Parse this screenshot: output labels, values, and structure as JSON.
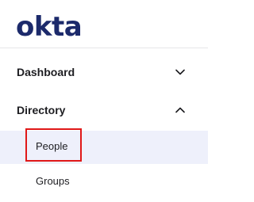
{
  "brand": {
    "logo_text": "okta"
  },
  "nav": {
    "dashboard": {
      "label": "Dashboard",
      "icon": "chevron-down-icon"
    },
    "directory": {
      "label": "Directory",
      "icon": "chevron-up-icon",
      "items": [
        {
          "label": "People",
          "selected": true
        },
        {
          "label": "Groups",
          "selected": false
        }
      ]
    }
  },
  "colors": {
    "logo": "#1c2a6b",
    "selected_bg": "#eef0fb",
    "annotation_box": "#e01818"
  }
}
